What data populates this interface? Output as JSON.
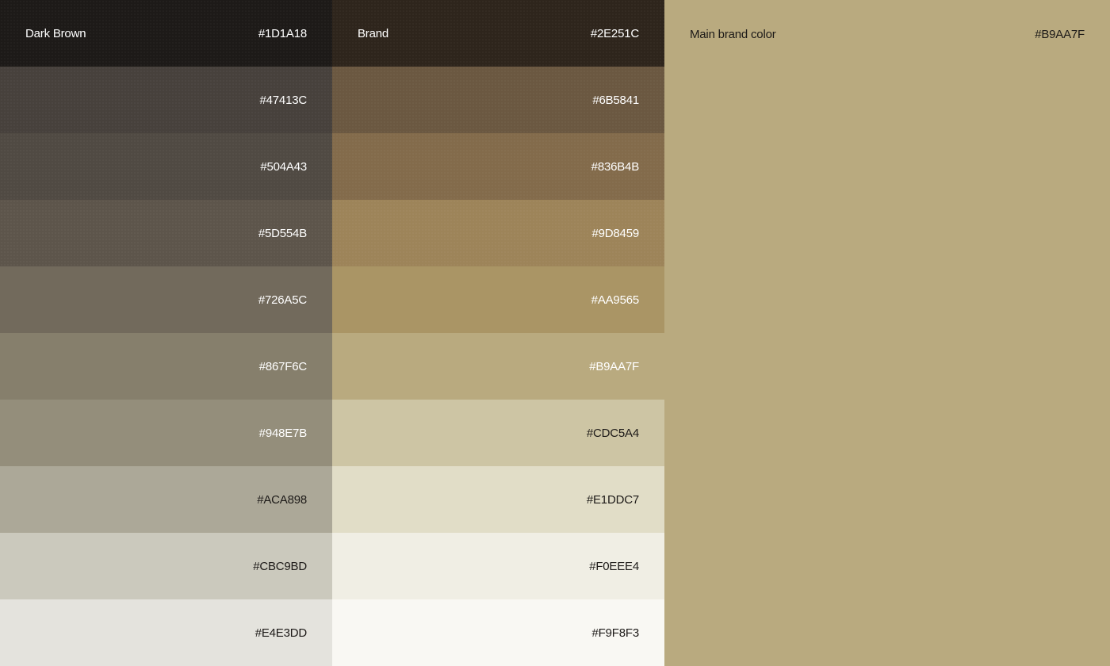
{
  "dark_brown": {
    "name": "Dark Brown",
    "swatches": [
      {
        "hex": "#1D1A18",
        "text": "light"
      },
      {
        "hex": "#47413C",
        "text": "light"
      },
      {
        "hex": "#504A43",
        "text": "light"
      },
      {
        "hex": "#5D554B",
        "text": "light"
      },
      {
        "hex": "#726A5C",
        "text": "light"
      },
      {
        "hex": "#867F6C",
        "text": "light"
      },
      {
        "hex": "#948E7B",
        "text": "light"
      },
      {
        "hex": "#ACA898",
        "text": "dark"
      },
      {
        "hex": "#CBC9BD",
        "text": "dark"
      },
      {
        "hex": "#E4E3DD",
        "text": "dark"
      }
    ]
  },
  "brand": {
    "name": "Brand",
    "swatches": [
      {
        "hex": "#2E251C",
        "text": "light"
      },
      {
        "hex": "#6B5841",
        "text": "light"
      },
      {
        "hex": "#836B4B",
        "text": "light"
      },
      {
        "hex": "#9D8459",
        "text": "light"
      },
      {
        "hex": "#AA9565",
        "text": "light"
      },
      {
        "hex": "#B9AA7F",
        "text": "light"
      },
      {
        "hex": "#CDC5A4",
        "text": "dark"
      },
      {
        "hex": "#E1DDC7",
        "text": "dark"
      },
      {
        "hex": "#F0EEE4",
        "text": "dark"
      },
      {
        "hex": "#F9F8F3",
        "text": "dark"
      }
    ]
  },
  "main_brand": {
    "label": "Main brand color",
    "hex": "#B9AA7F"
  }
}
